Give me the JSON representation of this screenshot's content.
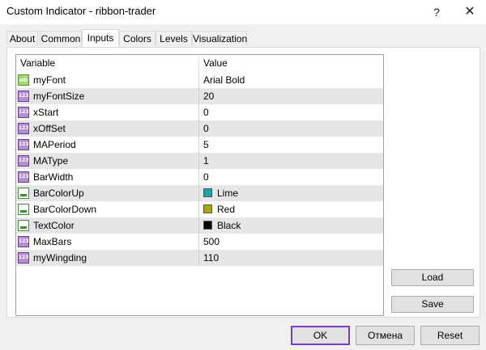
{
  "window": {
    "title": "Custom Indicator - ribbon-trader",
    "help_glyph": "?",
    "close_glyph": "✕"
  },
  "tabs": [
    {
      "label": "About"
    },
    {
      "label": "Common"
    },
    {
      "label": "Inputs",
      "active": true
    },
    {
      "label": "Colors"
    },
    {
      "label": "Levels"
    },
    {
      "label": "Visualization"
    }
  ],
  "grid": {
    "headers": {
      "variable": "Variable",
      "value": "Value"
    },
    "rows": [
      {
        "type": "string",
        "icon": "ab",
        "name": "myFont",
        "value": "Arial Bold"
      },
      {
        "type": "int",
        "icon": "123",
        "name": "myFontSize",
        "value": "20"
      },
      {
        "type": "int",
        "icon": "123",
        "name": "xStart",
        "value": "0"
      },
      {
        "type": "int",
        "icon": "123",
        "name": "xOffSet",
        "value": "0"
      },
      {
        "type": "int",
        "icon": "123",
        "name": "MAPeriod",
        "value": "5"
      },
      {
        "type": "int",
        "icon": "123",
        "name": "MAType",
        "value": "1"
      },
      {
        "type": "int",
        "icon": "123",
        "name": "BarWidth",
        "value": "0"
      },
      {
        "type": "color",
        "icon": "",
        "name": "BarColorUp",
        "value": "Lime",
        "swatch": "#1ba3a9"
      },
      {
        "type": "color",
        "icon": "",
        "name": "BarColorDown",
        "value": "Red",
        "swatch": "#a8a80f"
      },
      {
        "type": "color",
        "icon": "",
        "name": "TextColor",
        "value": "Black",
        "swatch": "#000000"
      },
      {
        "type": "int",
        "icon": "123",
        "name": "MaxBars",
        "value": "500"
      },
      {
        "type": "int",
        "icon": "123",
        "name": "myWingding",
        "value": "110"
      }
    ]
  },
  "buttons": {
    "load": "Load",
    "save": "Save",
    "ok": "OK",
    "cancel": "Отмена",
    "reset": "Reset"
  },
  "colors": {
    "ok_border": "#7a3fbf",
    "row_alt": "#e6e6e6",
    "dialog_bg": "#f0f0f0"
  }
}
